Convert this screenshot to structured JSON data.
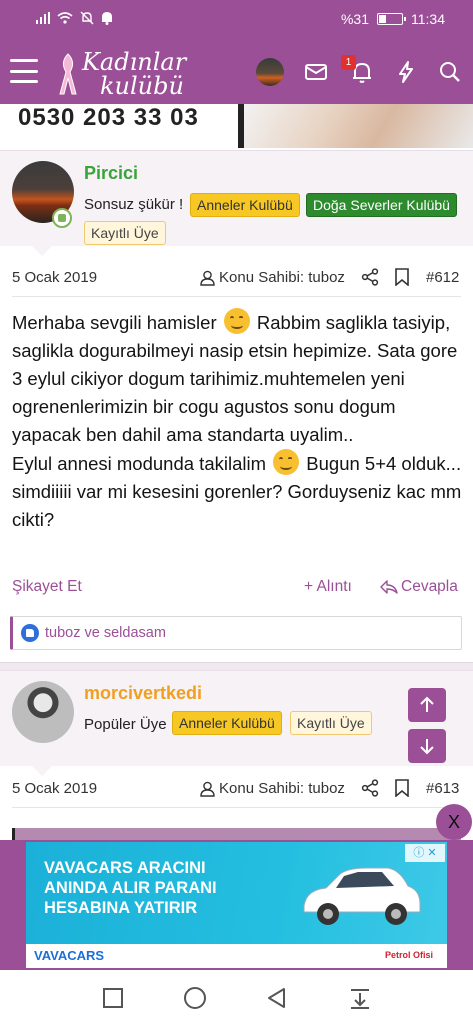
{
  "status_bar": {
    "battery_text": "%31",
    "time": "11:34",
    "battery_level": 0.31
  },
  "header": {
    "logo_line1": "Kadınlar",
    "logo_line2": "kulübü",
    "notification_count": "1"
  },
  "banner": {
    "phone": "0530 203 33 03"
  },
  "post1": {
    "username": "Pircici",
    "user_title": "Sonsuz şükür !",
    "badges": [
      "Anneler Kulübü",
      "Doğa Severler Kulübü",
      "Kayıtlı Üye"
    ],
    "date": "5 Ocak 2019",
    "owner_label": "Konu Sahibi: tuboz",
    "post_number": "#612",
    "body_part1": "Merhaba sevgili hamisler",
    "body_part2": "Rabbim saglikla tasiyip, saglikla dogurabilmeyi nasip etsin hepimize. Sata gore 3 eylul cikiyor dogum tarihimiz.muhtemelen yeni ogrenenlerimizin bir cogu agustos sonu dogum yapacak ben dahil ama standarta uyalim..",
    "body_part3": "Eylul annesi modunda takilalim",
    "body_part4": "Bugun 5+4 olduk... simdiiiii var mi kesesini gorenler? Gorduyseniz kac mm cikti?",
    "report_label": "Şikayet Et",
    "quote_label": "+ Alıntı",
    "reply_label": "Cevapla",
    "likes_text": "tuboz ve seldasam"
  },
  "post2": {
    "username": "morcivertkedi",
    "user_title": "Popüler Üye",
    "badges": [
      "Anneler Kulübü",
      "Kayıtlı Üye"
    ],
    "date": "5 Ocak 2019",
    "owner_label": "Konu Sahibi: tuboz",
    "post_number": "#613"
  },
  "ad": {
    "headline_1": "VAVACARS ARACINI",
    "headline_2": "ANINDA ALIR PARANI",
    "headline_3": "HESABINA YATIRIR",
    "brand": "VAVACARS",
    "sponsor": "Petrol Ofisi",
    "close_label": "X"
  },
  "colors": {
    "brand_purple": "#9b4f96",
    "user_green": "#3aa33a",
    "user_orange": "#f0a020"
  }
}
